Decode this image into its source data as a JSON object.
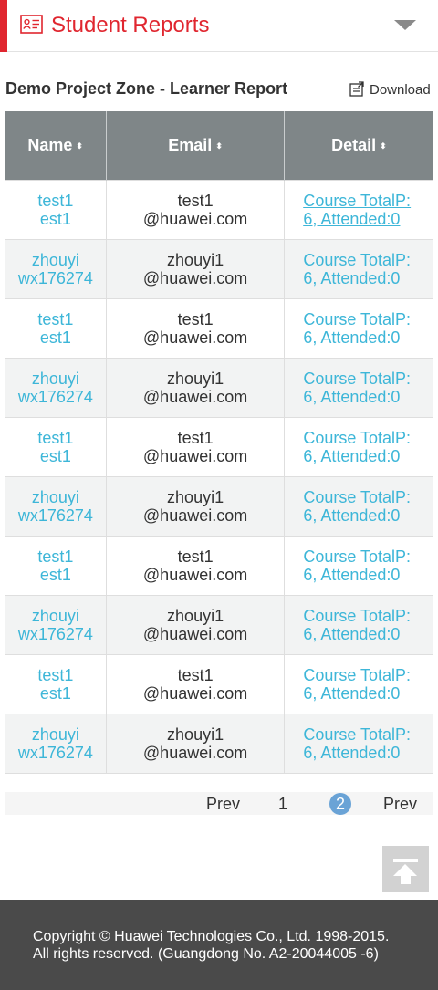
{
  "header": {
    "title": "Student Reports",
    "icon": "report-card-icon",
    "accent_color": "#e0262f",
    "dropdown_icon": "caret-down-icon"
  },
  "report": {
    "title": "Demo Project Zone - Learner Report",
    "download_label": "Download",
    "download_icon": "download-icon"
  },
  "table": {
    "columns": [
      {
        "label": "Name",
        "sort_glyph": "⬍"
      },
      {
        "label": "Email",
        "sort_glyph": "⬍"
      },
      {
        "label": "Detail",
        "sort_glyph": "⬍"
      }
    ],
    "rows": [
      {
        "name": [
          "test1",
          "est1"
        ],
        "email": [
          "test1",
          "@huawei.com"
        ],
        "detail": [
          "Course TotalP:",
          "6, Attended:0"
        ]
      },
      {
        "name": [
          "zhouyi",
          "wx176274"
        ],
        "email": [
          "zhouyi1",
          "@huawei.com"
        ],
        "detail": [
          "Course TotalP:",
          "6, Attended:0"
        ]
      },
      {
        "name": [
          "test1",
          "est1"
        ],
        "email": [
          "test1",
          "@huawei.com"
        ],
        "detail": [
          "Course TotalP:",
          "6, Attended:0"
        ]
      },
      {
        "name": [
          "zhouyi",
          "wx176274"
        ],
        "email": [
          "zhouyi1",
          "@huawei.com"
        ],
        "detail": [
          "Course TotalP:",
          "6, Attended:0"
        ]
      },
      {
        "name": [
          "test1",
          "est1"
        ],
        "email": [
          "test1",
          "@huawei.com"
        ],
        "detail": [
          "Course TotalP:",
          "6, Attended:0"
        ]
      },
      {
        "name": [
          "zhouyi",
          "wx176274"
        ],
        "email": [
          "zhouyi1",
          "@huawei.com"
        ],
        "detail": [
          "Course TotalP:",
          "6, Attended:0"
        ]
      },
      {
        "name": [
          "test1",
          "est1"
        ],
        "email": [
          "test1",
          "@huawei.com"
        ],
        "detail": [
          "Course TotalP:",
          "6, Attended:0"
        ]
      },
      {
        "name": [
          "zhouyi",
          "wx176274"
        ],
        "email": [
          "zhouyi1",
          "@huawei.com"
        ],
        "detail": [
          "Course TotalP:",
          "6, Attended:0"
        ]
      },
      {
        "name": [
          "test1",
          "est1"
        ],
        "email": [
          "test1",
          "@huawei.com"
        ],
        "detail": [
          "Course TotalP:",
          "6, Attended:0"
        ]
      },
      {
        "name": [
          "zhouyi",
          "wx176274"
        ],
        "email": [
          "zhouyi1",
          "@huawei.com"
        ],
        "detail": [
          "Course TotalP:",
          "6, Attended:0"
        ]
      }
    ]
  },
  "pagination": {
    "prev_label": "Prev",
    "page_1": "1",
    "page_2": "2",
    "current_page": "2",
    "next_label": "Prev"
  },
  "back_to_top": {
    "icon": "back-to-top-icon"
  },
  "footer": {
    "line1": "Copyright © Huawei Technologies Co., Ltd. 1998-2015.",
    "line2": "All rights reserved. (Guangdong No. A2-20044005 -6)"
  },
  "colors": {
    "link": "#3db6d8",
    "table_header_bg": "#7f8688",
    "footer_bg": "#4a4a4a",
    "current_page_bg": "#6aa3d6"
  }
}
